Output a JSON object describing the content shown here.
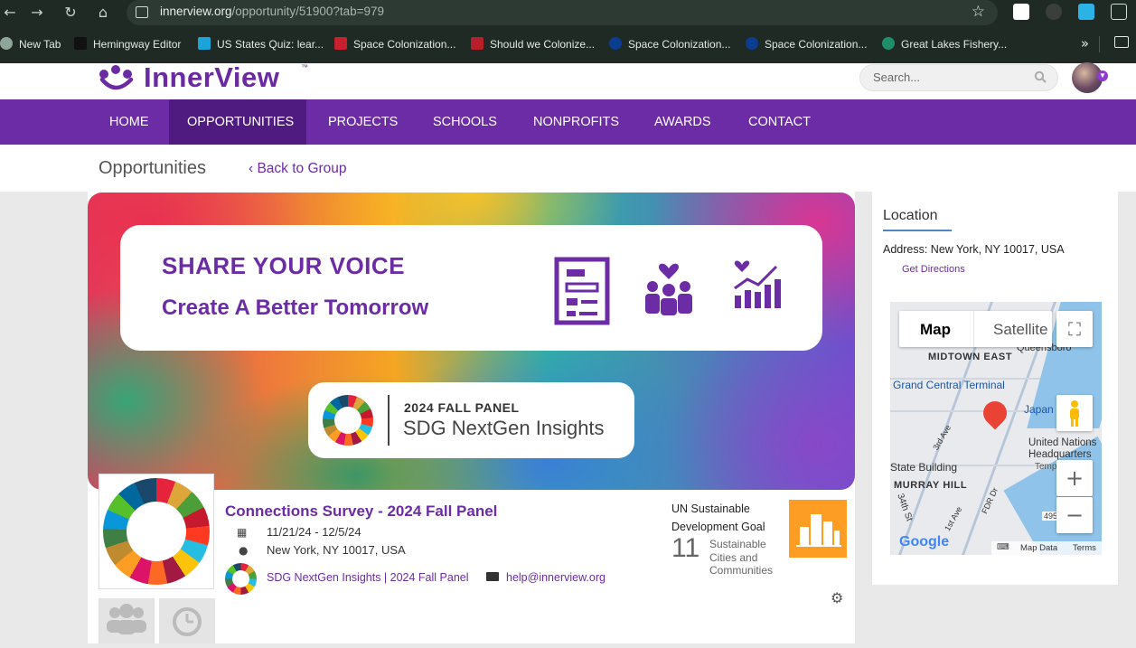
{
  "browser": {
    "url_host": "innerview.org",
    "url_path": "/opportunity/51900?tab=979",
    "bookmarks": [
      "New Tab",
      "Hemingway Editor",
      "US States Quiz: lear...",
      "Space Colonization...",
      "Should we Colonize...",
      "Space Colonization...",
      "Space Colonization...",
      "Great Lakes Fishery..."
    ]
  },
  "site": {
    "logo_text": "InnerView",
    "logo_tm": "™",
    "search_placeholder": "Search..."
  },
  "nav": [
    "HOME",
    "OPPORTUNITIES",
    "PROJECTS",
    "SCHOOLS",
    "NONPROFITS",
    "AWARDS",
    "CONTACT"
  ],
  "subhead": {
    "title": "Opportunities",
    "back": "‹ Back to Group"
  },
  "banner": {
    "line1": "SHARE YOUR VOICE",
    "line2": "Create A Better Tomorrow",
    "panel_year": "2024 FALL PANEL",
    "panel_name": "SDG NextGen Insights"
  },
  "opportunity": {
    "title": "Connections Survey - 2024 Fall Panel",
    "dates": "11/21/24 - 12/5/24",
    "location": "New York, NY 10017, USA",
    "group": "SDG NextGen Insights | 2024 Fall Panel",
    "email": "help@innerview.org"
  },
  "sdg": {
    "heading": "UN Sustainable Development Goal",
    "number": "11",
    "name": "Sustainable Cities and Communities",
    "color": "#fd9d24"
  },
  "sidebar": {
    "heading": "Location",
    "address": "Address: New York, NY 10017, USA",
    "directions": "Get Directions"
  },
  "map": {
    "type_map": "Map",
    "type_satellite": "Satellite",
    "labels": [
      "Queensboro",
      "MIDTOWN EAST",
      "Grand Central Terminal",
      "Japan Society",
      "United Nations Headquarters",
      "Tempo",
      "State Building",
      "MURRAY HILL",
      "3rd Ave",
      "1st Ave",
      "34th St",
      "FDR Dr",
      "495"
    ],
    "google": "Google",
    "keyboard": "⌨",
    "attribution_data": "Map Data",
    "attribution_terms": "Terms"
  }
}
